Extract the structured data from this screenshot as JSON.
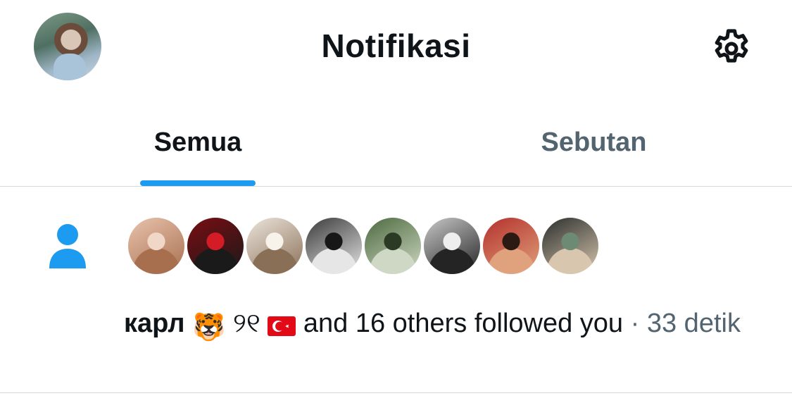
{
  "header": {
    "title": "Notifikasi",
    "avatar_icon": "profile-avatar",
    "settings_icon": "gear-icon"
  },
  "tabs": [
    {
      "label": "Semua",
      "active": true
    },
    {
      "label": "Sebutan",
      "active": false
    }
  ],
  "notification": {
    "type_icon": "person-icon",
    "follower_avatars": [
      {
        "icon": "avatar-1",
        "colors": [
          "#e8c3ad",
          "#a86f4f",
          "#f0d7c8"
        ]
      },
      {
        "icon": "avatar-2",
        "colors": [
          "#7a0d12",
          "#1a1a1a",
          "#d41c27"
        ]
      },
      {
        "icon": "avatar-3",
        "colors": [
          "#ece5dc",
          "#8a6f57",
          "#f7f2ea"
        ]
      },
      {
        "icon": "avatar-4",
        "colors": [
          "#3a3a3a",
          "#e6e6e6",
          "#171717"
        ]
      },
      {
        "icon": "avatar-5",
        "colors": [
          "#4c6a3f",
          "#cfd8c4",
          "#2b3a25"
        ]
      },
      {
        "icon": "avatar-6",
        "colors": [
          "#c8c8c8",
          "#242424",
          "#eeeeee"
        ]
      },
      {
        "icon": "avatar-7",
        "colors": [
          "#b4302c",
          "#e0a27c",
          "#2b1a14"
        ]
      },
      {
        "icon": "avatar-8",
        "colors": [
          "#2a2e2c",
          "#d8c6ae",
          "#6d8b74"
        ]
      }
    ],
    "actor_name": "карл",
    "actor_emoji": "🐯",
    "actor_suffix": "୨୧",
    "actor_flag": "turkey-flag-icon",
    "action_text": " and 16 others followed you",
    "separator": " · ",
    "timestamp": "33 detik"
  },
  "colors": {
    "accent": "#1d9bf0",
    "text_primary": "#0f1419",
    "text_secondary": "#536471",
    "divider": "#cfd9de"
  }
}
